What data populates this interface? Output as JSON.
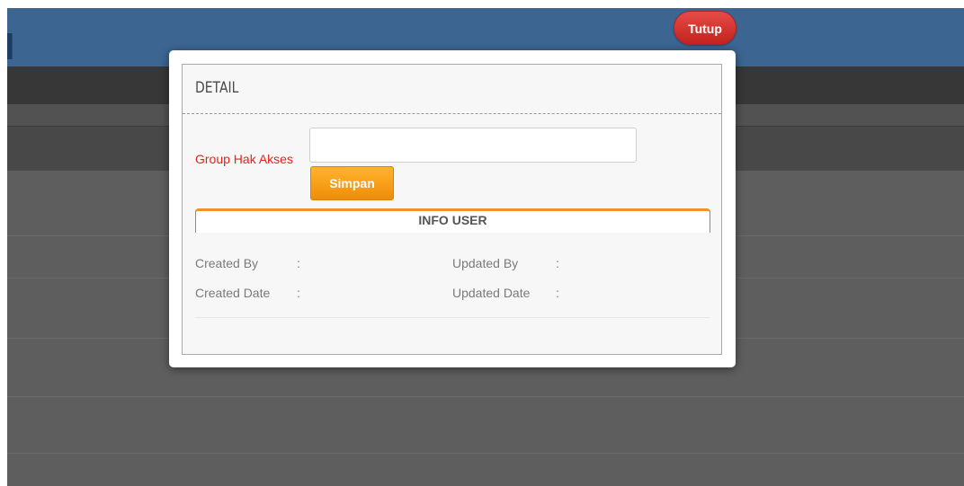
{
  "header": {
    "close_label": "Tutup"
  },
  "modal": {
    "title": "DETAIL",
    "form": {
      "group_label": "Group Hak Akses",
      "group_value": "",
      "group_placeholder": "",
      "save_label": "Simpan"
    },
    "info": {
      "title": "INFO USER",
      "created_by_label": "Created By",
      "created_date_label": "Created Date",
      "updated_by_label": "Updated By",
      "updated_date_label": "Updated Date",
      "separator": ":"
    }
  },
  "colors": {
    "top_bar": "#3c6591",
    "close_button": "#d9342f",
    "save_button": "#f7a11c",
    "required_label": "#e8201c",
    "info_accent": "#f0922a"
  }
}
